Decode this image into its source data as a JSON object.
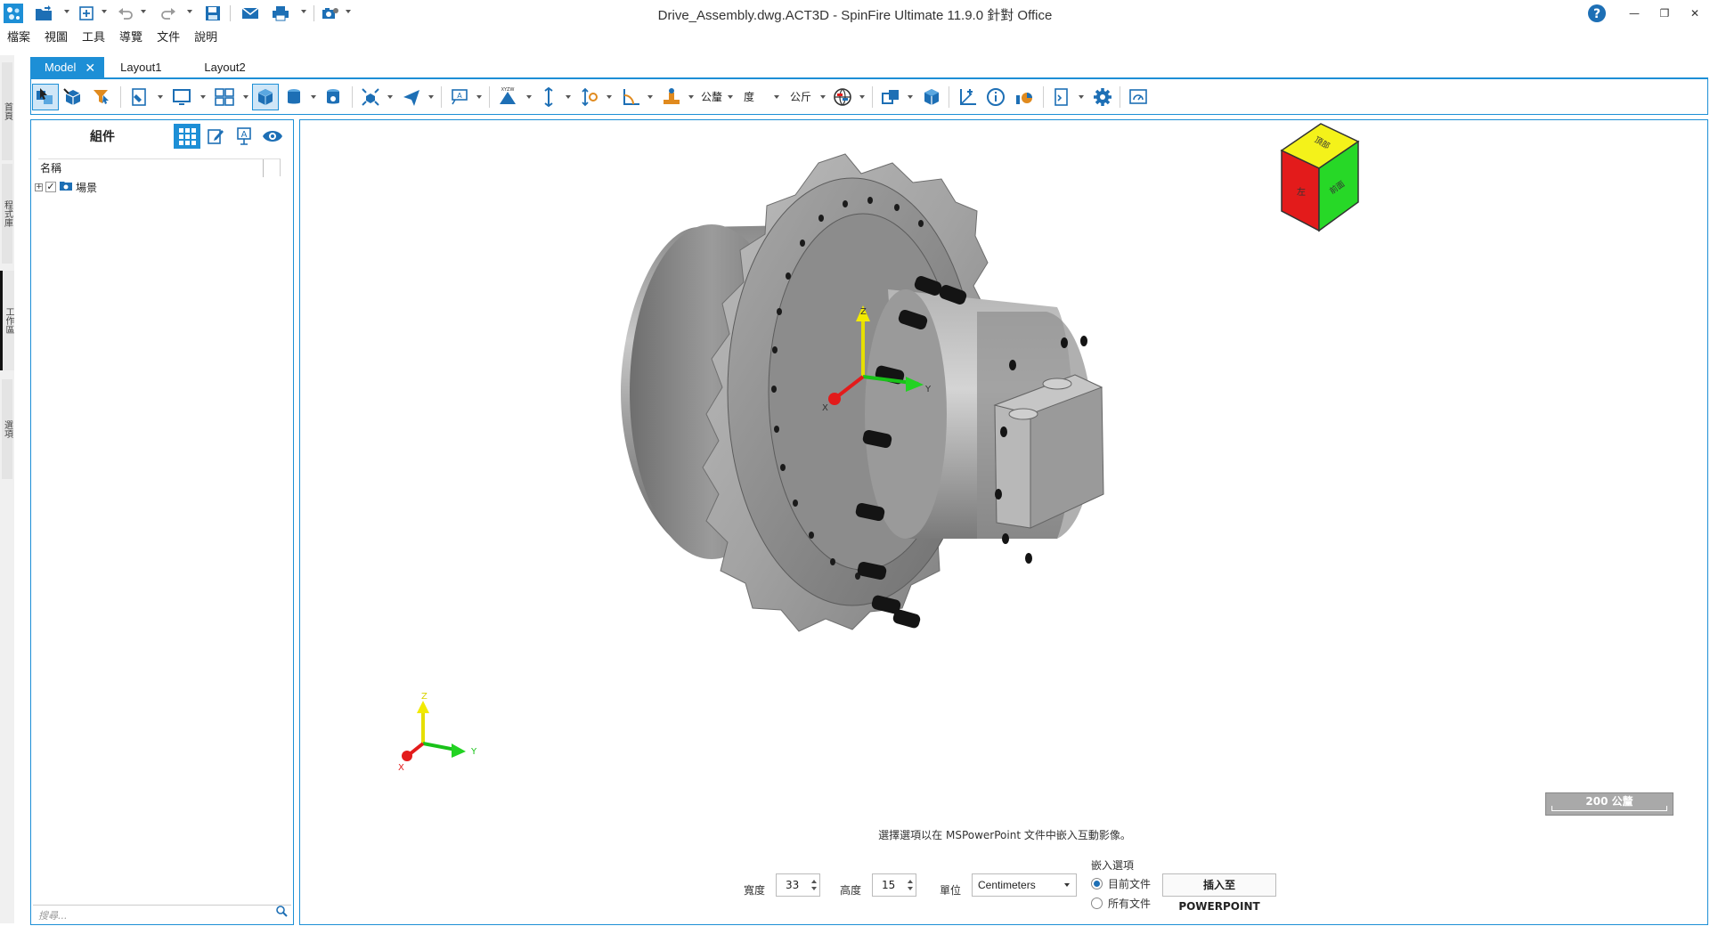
{
  "window": {
    "title": "Drive_Assembly.dwg.ACT3D - SpinFire Ultimate 11.9.0 針對 Office",
    "help_icon": "question-circle-icon",
    "minimize_symbol": "—",
    "restore_symbol": "❐",
    "close_symbol": "✕"
  },
  "menu": [
    "檔案",
    "視圖",
    "工具",
    "導覽",
    "文件",
    "說明"
  ],
  "side_tabs": [
    "首頁",
    "程式庫",
    "工作區",
    "選項"
  ],
  "doc_tabs": {
    "model": "Model",
    "layout1": "Layout1",
    "layout2": "Layout2",
    "close_symbol": "✕"
  },
  "toolbar": {
    "tolerance_label": "公釐",
    "angle_label": "度",
    "weight_label": "公斤",
    "section_label": "XYZW"
  },
  "panel": {
    "title": "組件",
    "column_name": "名稱",
    "tree_root": "場景",
    "expander": "+",
    "check": "✓",
    "search_placeholder": "搜尋..."
  },
  "viewport": {
    "view_cube": {
      "top": "頂部",
      "front": "左",
      "right": "前面"
    },
    "triad_axes": {
      "x": "X",
      "y": "Y",
      "z": "Z"
    },
    "corner_axes": {
      "x": "X",
      "y": "Y",
      "z": "Z"
    },
    "scale_bar": "200 公釐",
    "embed_message": "選擇選項以在 MSPowerPoint 文件中嵌入互動影像。",
    "width_label": "寬度",
    "width_value": "33",
    "height_label": "高度",
    "height_value": "15",
    "unit_label": "單位",
    "unit_value": "Centimeters",
    "embed_options_label": "嵌入選項",
    "option_current": "目前文件",
    "option_all": "所有文件",
    "insert_button": "插入至 POWERPOINT"
  },
  "colors": {
    "accent": "#1d8fd6",
    "cube_top": "#f4f21a",
    "cube_front": "#e31b1b",
    "cube_right": "#27d827"
  }
}
